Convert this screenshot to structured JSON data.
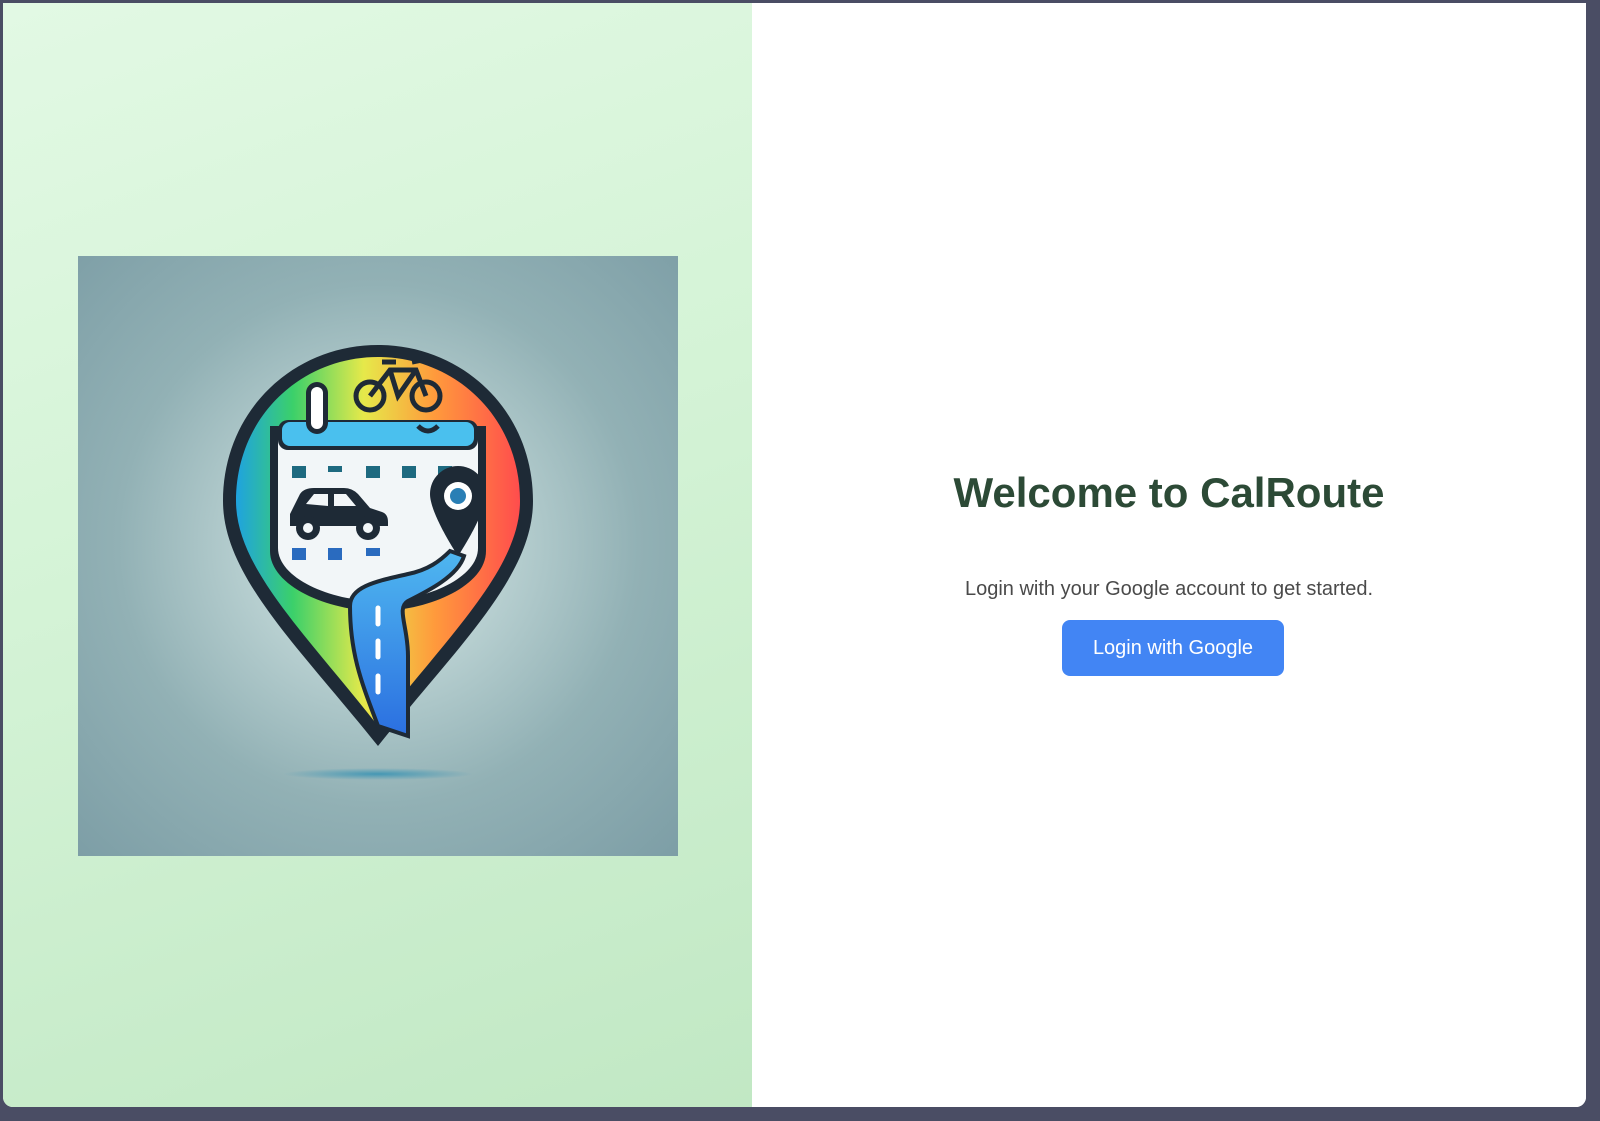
{
  "colors": {
    "left_panel_bg": "#d4f3d6",
    "heading": "#2c4a36",
    "button_bg": "#4285f4",
    "button_text": "#ffffff",
    "subtitle": "#4a4a4a"
  },
  "left_panel": {
    "logo_icon": "calroute-logo-icon"
  },
  "main": {
    "title": "Welcome to CalRoute",
    "subtitle": "Login with your Google account to get started.",
    "login_button_label": "Login with Google"
  }
}
